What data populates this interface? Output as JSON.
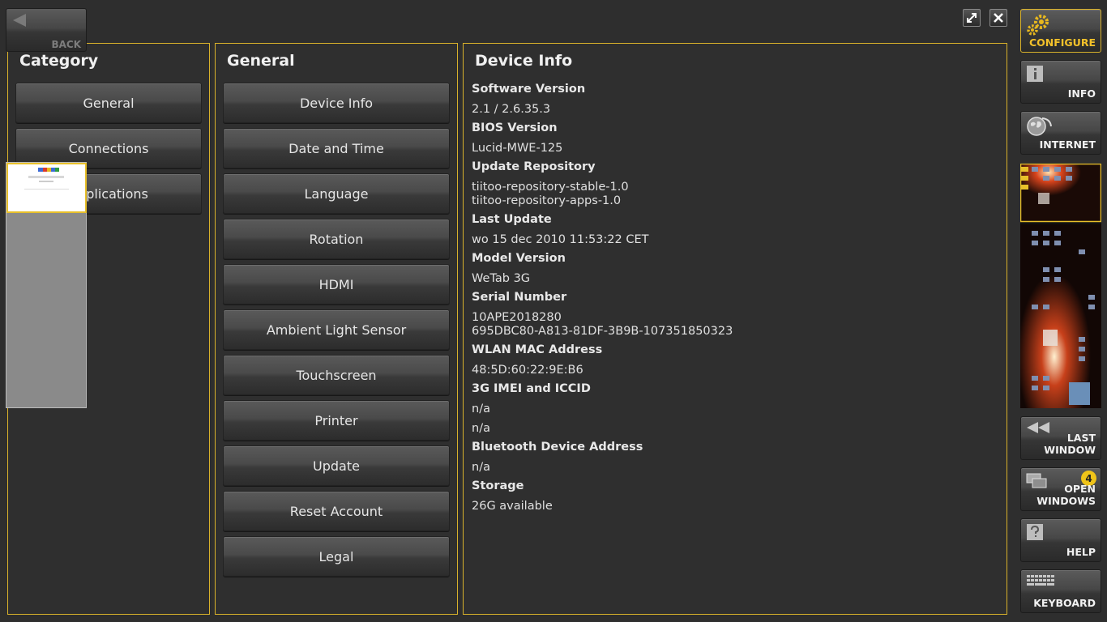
{
  "back": {
    "label": "BACK",
    "icon": "back-arrow-icon"
  },
  "window_controls": {
    "maximize_icon": "maximize-icon",
    "close_icon": "close-icon"
  },
  "category": {
    "title": "Category",
    "items": [
      "General",
      "Connections",
      "Applications"
    ]
  },
  "general": {
    "title": "General",
    "items": [
      "Device Info",
      "Date and Time",
      "Language",
      "Rotation",
      "HDMI",
      "Ambient Light Sensor",
      "Touchscreen",
      "Printer",
      "Update",
      "Reset Account",
      "Legal"
    ]
  },
  "device_info": {
    "title": "Device Info",
    "software_version_label": "Software Version",
    "software_version": "2.1 / 2.6.35.3",
    "bios_version_label": "BIOS Version",
    "bios_version": "Lucid-MWE-125",
    "update_repository_label": "Update Repository",
    "update_repository": "tiitoo-repository-stable-1.0\ntiitoo-repository-apps-1.0",
    "last_update_label": "Last Update",
    "last_update": "wo 15 dec 2010 11:53:22 CET",
    "model_version_label": "Model Version",
    "model_version": "WeTab 3G",
    "serial_number_label": "Serial Number",
    "serial_number": "10APE2018280\n695DBC80-A813-81DF-3B9B-107351850323",
    "wlan_mac_label": "WLAN MAC Address",
    "wlan_mac": "48:5D:60:22:9E:B6",
    "imei_iccid_label": "3G IMEI and ICCID",
    "imei": "n/a",
    "iccid": "n/a",
    "bluetooth_label": "Bluetooth Device Address",
    "bluetooth": "n/a",
    "storage_label": "Storage",
    "storage": "26G available"
  },
  "sidebar": {
    "configure": "CONFIGURE",
    "info": "INFO",
    "internet": "INTERNET",
    "last_window": "LAST\nWINDOW",
    "open_windows": "OPEN\nWINDOWS",
    "open_windows_count": "4",
    "help": "HELP",
    "keyboard": "KEYBOARD"
  },
  "colors": {
    "accent": "#d9b22b",
    "active_text": "#f3c12a",
    "background": "#2e2e2e"
  }
}
